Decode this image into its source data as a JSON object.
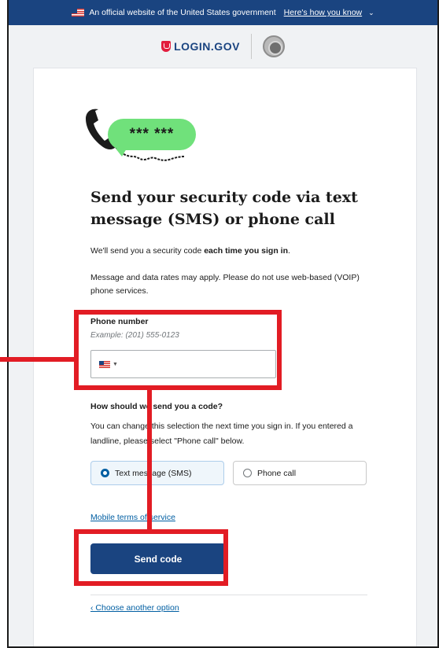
{
  "gov_banner": {
    "text": "An official website of the United States government",
    "link": "Here's how you know",
    "flag_icon": "us-flag-icon",
    "chevron_icon": "chevron-down-icon"
  },
  "header": {
    "logo_text": "LOGIN.GOV",
    "logo_icon": "login-gov-shield-icon",
    "agency_seal": "agency-seal-icon"
  },
  "illustration": {
    "bubble_text": "*** ***",
    "icon": "phone-handset-icon"
  },
  "main": {
    "title": "Send your security code via text message (SMS) or phone call",
    "intro_prefix": "We'll send you a security code ",
    "intro_bold": "each time you sign in",
    "intro_suffix": ".",
    "rates_notice": "Message and data rates may apply. Please do not use web-based (VOIP) phone services."
  },
  "phone_field": {
    "label": "Phone number",
    "hint": "Example: (201) 555-0123",
    "value": "",
    "country": "United States"
  },
  "delivery": {
    "label": "How should we send you a code?",
    "description": "You can change this selection the next time you sign in. If you entered a landline, please select \"Phone call\" below.",
    "options": [
      {
        "label": "Text message (SMS)",
        "selected": true
      },
      {
        "label": "Phone call",
        "selected": false
      }
    ]
  },
  "links": {
    "terms": "Mobile terms of service",
    "back": "‹ Choose another option"
  },
  "actions": {
    "send_label": "Send code"
  },
  "colors": {
    "primary": "#1a4480",
    "link": "#005ea2",
    "annotation": "#e21c24",
    "bubble": "#70e17b"
  }
}
